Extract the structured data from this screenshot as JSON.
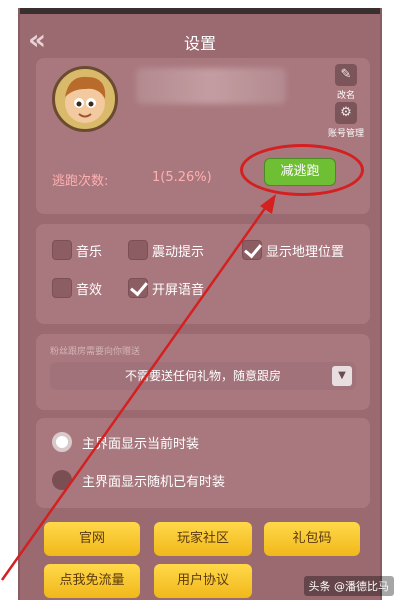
{
  "header": {
    "back_icon": "double-chevron-left-icon",
    "title": "设置"
  },
  "profile": {
    "rename_label": "改名",
    "account_label": "账号管理",
    "escape_label": "逃跑次数:",
    "escape_value": "1(5.26%)",
    "reduce_button": "减逃跑"
  },
  "options": {
    "items": [
      {
        "label": "音乐",
        "checked": false
      },
      {
        "label": "震动提示",
        "checked": false
      },
      {
        "label": "显示地理位置",
        "checked": true
      },
      {
        "label": "音效",
        "checked": false
      },
      {
        "label": "开屏语音",
        "checked": true
      }
    ]
  },
  "room": {
    "hint": "粉丝跟房需要向你赠送",
    "selected": "不需要送任何礼物，随意跟房"
  },
  "display": {
    "options": [
      {
        "label": "主界面显示当前时装",
        "selected": true
      },
      {
        "label": "主界面显示随机已有时装",
        "selected": false
      }
    ]
  },
  "buttons": {
    "official": "官网",
    "community": "玩家社区",
    "gift_code": "礼包码",
    "free_data": "点我免流量",
    "agreement": "用户协议"
  },
  "watermark": "头条 @潘德比马",
  "colors": {
    "annotation": "#d42020",
    "reduce_button": "#6fbf34",
    "yellow_button": "#f1b81a"
  }
}
